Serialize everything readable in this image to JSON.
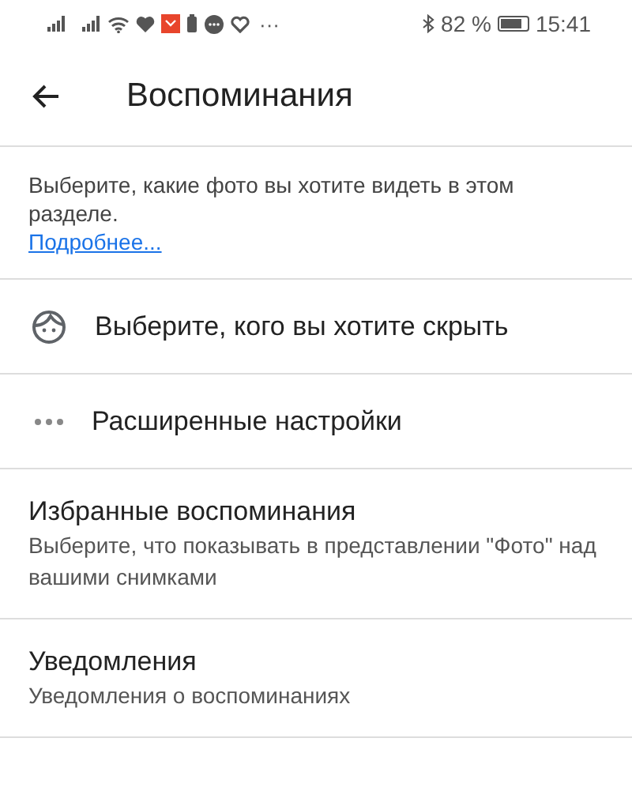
{
  "status_bar": {
    "battery_percent": "82 %",
    "time": "15:41",
    "more": "···"
  },
  "header": {
    "title": "Воспоминания"
  },
  "intro": {
    "text": "Выберите, какие фото вы хотите видеть в этом разделе.",
    "link": "Подробнее..."
  },
  "items": [
    {
      "kind": "face",
      "label": "Выберите, кого вы хотите скрыть"
    },
    {
      "kind": "dots",
      "label": "Расширенные настройки"
    },
    {
      "kind": "text",
      "label": "Избранные воспоминания",
      "description": "Выберите, что показывать в представлении \"Фото\" над вашими снимками"
    },
    {
      "kind": "text",
      "label": "Уведомления",
      "description": "Уведомления о воспоминаниях"
    }
  ]
}
